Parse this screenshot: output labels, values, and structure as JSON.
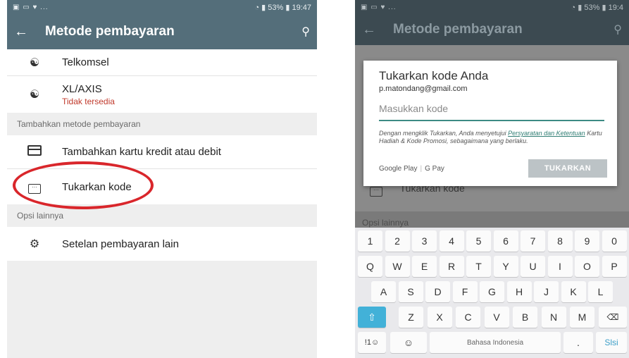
{
  "left": {
    "status": {
      "left_icons": "▣ ▭ ♥ ...",
      "right_text": "53%",
      "time": "19:47"
    },
    "appbar": {
      "title": "Metode pembayaran"
    },
    "methods": [
      {
        "label": "Telkomsel"
      },
      {
        "label": "XL/AXIS",
        "sublabel": "Tidak tersedia"
      }
    ],
    "section_add": "Tambahkan metode pembayaran",
    "add_items": [
      {
        "label": "Tambahkan kartu kredit atau debit"
      },
      {
        "label": "Tukarkan kode"
      }
    ],
    "section_other": "Opsi lainnya",
    "other_items": [
      {
        "label": "Setelan pembayaran lain"
      }
    ]
  },
  "right": {
    "status": {
      "left_icons": "▣ ▭ ♥ ...",
      "right_text": "53%",
      "time": "19:4"
    },
    "appbar": {
      "title": "Metode pembayaran"
    },
    "bg_item": "Tukarkan kode",
    "bg_section": "Opsi lainnya",
    "dialog": {
      "title": "Tukarkan kode Anda",
      "email": "p.matondang@gmail.com",
      "placeholder": "Masukkan kode",
      "terms_prefix": "Dengan mengklik Tukarkan, Anda menyetujui ",
      "terms_link": "Persyaratan dan Ketentuan",
      "terms_suffix": " Kartu Hadiah & Kode Promosi, sebagaimana yang berlaku.",
      "brand_play": "Google Play",
      "brand_pay": "G Pay",
      "button": "TUKARKAN"
    },
    "keyboard": {
      "row1": [
        "1",
        "2",
        "3",
        "4",
        "5",
        "6",
        "7",
        "8",
        "9",
        "0"
      ],
      "row2": [
        "Q",
        "W",
        "E",
        "R",
        "T",
        "Y",
        "U",
        "I",
        "O",
        "P"
      ],
      "row3": [
        "A",
        "S",
        "D",
        "F",
        "G",
        "H",
        "J",
        "K",
        "L"
      ],
      "row4": [
        "Z",
        "X",
        "C",
        "V",
        "B",
        "N",
        "M"
      ],
      "sym": "!1☺",
      "space": "Bahasa Indonesia",
      "period": ".",
      "done": "Slsi"
    }
  }
}
